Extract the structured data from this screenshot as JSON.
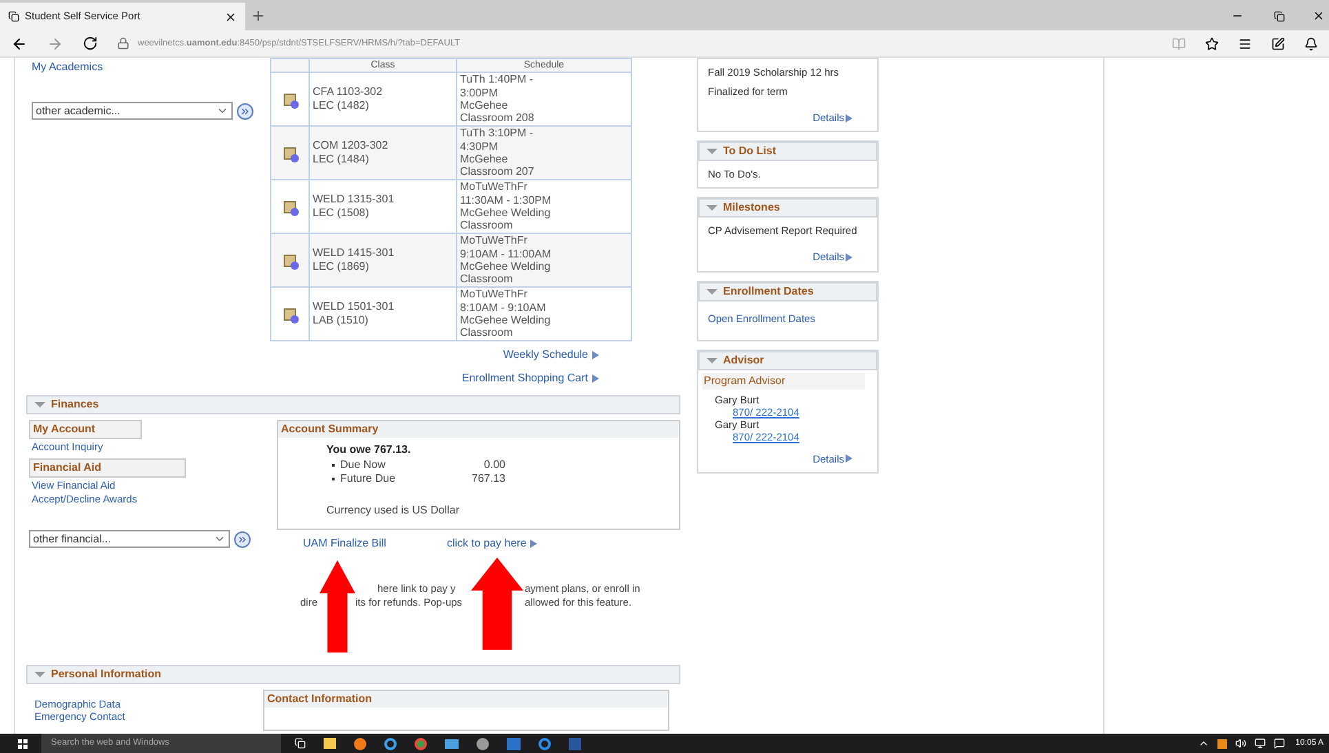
{
  "browser": {
    "tab_title": "Student Self Service Port",
    "address": "weevilnetcs.**uamont.edu**:8450/psp/stdnt/STSELFSERV/HRMS/h/?tab=DEFAULT"
  },
  "academics": {
    "link": "My Academics",
    "dropdown": {
      "value": "other academic..."
    },
    "table": {
      "columns": [
        "Class",
        "Schedule"
      ],
      "rows": [
        {
          "class": [
            "CFA 1103-302",
            "LEC (1482)"
          ],
          "schedule": [
            "TuTh 1:40PM -",
            "3:00PM",
            "McGehee",
            "Classroom 208"
          ]
        },
        {
          "class": [
            "COM 1203-302",
            "LEC (1484)"
          ],
          "schedule": [
            "TuTh 3:10PM -",
            "4:30PM",
            "McGehee",
            "Classroom 207"
          ]
        },
        {
          "class": [
            "WELD 1315-301",
            "LEC (1508)"
          ],
          "schedule": [
            "MoTuWeThFr",
            "11:30AM - 1:30PM",
            "McGehee Welding",
            "Classroom"
          ]
        },
        {
          "class": [
            "WELD 1415-301",
            "LEC (1869)"
          ],
          "schedule": [
            "MoTuWeThFr",
            "9:10AM - 11:00AM",
            "McGehee Welding",
            "Classroom"
          ]
        },
        {
          "class": [
            "WELD 1501-301",
            "LAB (1510)"
          ],
          "schedule": [
            "MoTuWeThFr",
            "8:10AM - 9:10AM",
            "McGehee Welding",
            "Classroom"
          ]
        }
      ]
    },
    "links": [
      "Weekly Schedule",
      "Enrollment Shopping Cart"
    ]
  },
  "finances": {
    "title": "Finances",
    "groups": [
      {
        "heading": "My Account",
        "links": [
          "Account Inquiry"
        ]
      },
      {
        "heading": "Financial Aid",
        "links": [
          "View Financial Aid",
          "Accept/Decline Awards"
        ]
      }
    ],
    "dropdown": {
      "value": "other financial..."
    },
    "summary": {
      "title": "Account Summary",
      "owe": "You owe 767.13.",
      "items": [
        {
          "label": "Due Now",
          "amount": "0.00"
        },
        {
          "label": "Future Due",
          "amount": "767.13"
        }
      ],
      "currency": "Currency used is US Dollar"
    },
    "links": [
      "UAM Finalize Bill",
      "click to pay here"
    ],
    "note_lines": [
      [
        "here link to pay y",
        "ayment plans, or enroll in"
      ],
      [
        "dire",
        "its for refunds. Pop-ups",
        "allowed for this feature."
      ]
    ]
  },
  "personal": {
    "title": "Personal Information",
    "links": [
      "Demographic Data",
      "Emergency Contact"
    ],
    "contact_title": "Contact Information"
  },
  "panels": [
    {
      "kind": "text",
      "lines": [
        "Fall 2019 Scholarship 12 hrs",
        "Finalized for term"
      ],
      "details": "Details"
    },
    {
      "kind": "text",
      "title": "To Do List",
      "lines": [
        "No To Do's."
      ]
    },
    {
      "kind": "text",
      "title": "Milestones",
      "lines": [
        "CP Advisement Report Required"
      ],
      "details": "Details"
    },
    {
      "kind": "links",
      "title": "Enrollment Dates",
      "links": [
        "Open Enrollment Dates"
      ]
    },
    {
      "kind": "advisor",
      "title": "Advisor",
      "subheading": "Program Advisor",
      "advisors": [
        {
          "name": "Gary Burt",
          "phone": "870/ 222-2104"
        },
        {
          "name": "Gary Burt",
          "phone": "870/ 222-2104"
        }
      ],
      "details": "Details"
    }
  ],
  "taskbar": {
    "search_placeholder": "Search the web and Windows",
    "clock": "10:05 A"
  }
}
